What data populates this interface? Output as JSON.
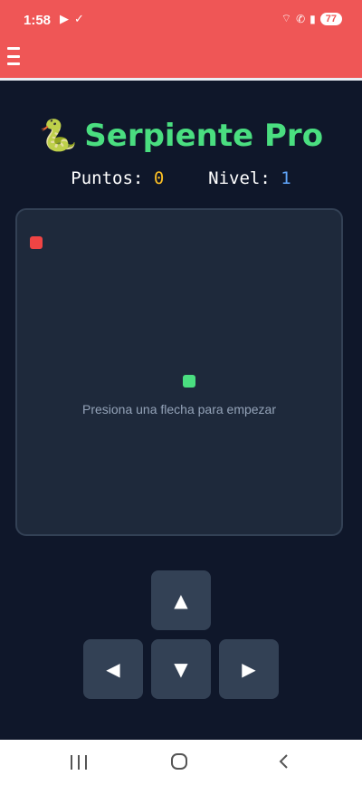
{
  "status_bar": {
    "time": "1:58",
    "icons": [
      "play-icon",
      "check-icon",
      "wifi-icon",
      "call-icon",
      "signal-icon"
    ],
    "battery": "77"
  },
  "app_bar": {
    "menu_icon": "hamburger-menu-icon",
    "color": "#ef5656"
  },
  "game": {
    "title_emoji": "🐍",
    "title": "Serpiente Pro",
    "score_label": "Puntos:",
    "score_value": "0",
    "level_label": "Nivel:",
    "level_value": "1",
    "hint": "Presiona una flecha para empezar"
  },
  "controls": {
    "up": "▲",
    "left": "◀",
    "down": "▼",
    "right": "▶"
  },
  "colors": {
    "background": "#0f172a",
    "board": "#1e293b",
    "title": "#4ade80",
    "score": "#fbbf24",
    "level": "#60a5fa",
    "food": "#ef4444",
    "snake": "#4ade80"
  },
  "nav_bar": {
    "recents": "recents-icon",
    "home": "home-icon",
    "back": "back-icon"
  }
}
